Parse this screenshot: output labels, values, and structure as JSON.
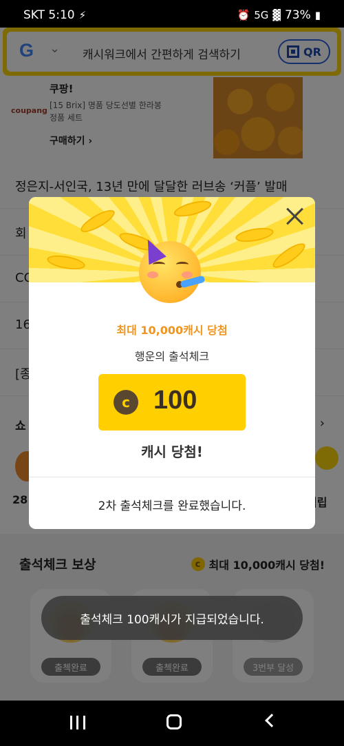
{
  "status_bar": {
    "carrier_time": "SKT 5:10",
    "network": "5G",
    "battery": "73%"
  },
  "search": {
    "engine_logo": "G",
    "placeholder": "캐시워크에서 간편하게 검색하기",
    "qr_label": "QR"
  },
  "ad": {
    "logo_text": "coupang",
    "brand": "쿠팡!",
    "description": "[15 Brix] 명품 당도선별 한라봉 정품 세트",
    "cta": "구매하기 ›"
  },
  "news": [
    {
      "title": "정은지-서인국, 13년 만에 달달한 러브송 ‘커플’ 발매"
    },
    {
      "title": "회"
    },
    {
      "title": "CO"
    },
    {
      "title": "16"
    },
    {
      "title": "[종"
    }
  ],
  "shopping": {
    "title": "쇼",
    "arrow": "›",
    "left_value": "28",
    "right_label": "적립"
  },
  "reward_section": {
    "title": "출석체크 보상",
    "subtitle": "최대 10,000캐시 당첨!",
    "cards": [
      {
        "label": "출첵완료",
        "state": "done"
      },
      {
        "label": "출첵완료",
        "state": "done"
      },
      {
        "label": "3번부 달성",
        "state": "pending"
      }
    ]
  },
  "toast": {
    "text": "출석체크 100캐시가 지급되었습니다."
  },
  "modal": {
    "headline": "최대 10,000캐시 당첨",
    "subtitle": "행운의 출석체크",
    "amount": "100",
    "coin_symbol": "c",
    "win_text": "캐시 당첨!",
    "message": "2차 출석체크를 완료했습니다."
  },
  "colors": {
    "brand_yellow": "#ffd60a",
    "accent_orange": "#f0941e",
    "qr_blue": "#2b5fd9"
  },
  "icons": [
    "signal-icon",
    "wifi-icon",
    "battery-icon",
    "qr-icon",
    "close-icon",
    "coin-icon",
    "recent-apps-icon",
    "home-icon",
    "back-icon"
  ]
}
